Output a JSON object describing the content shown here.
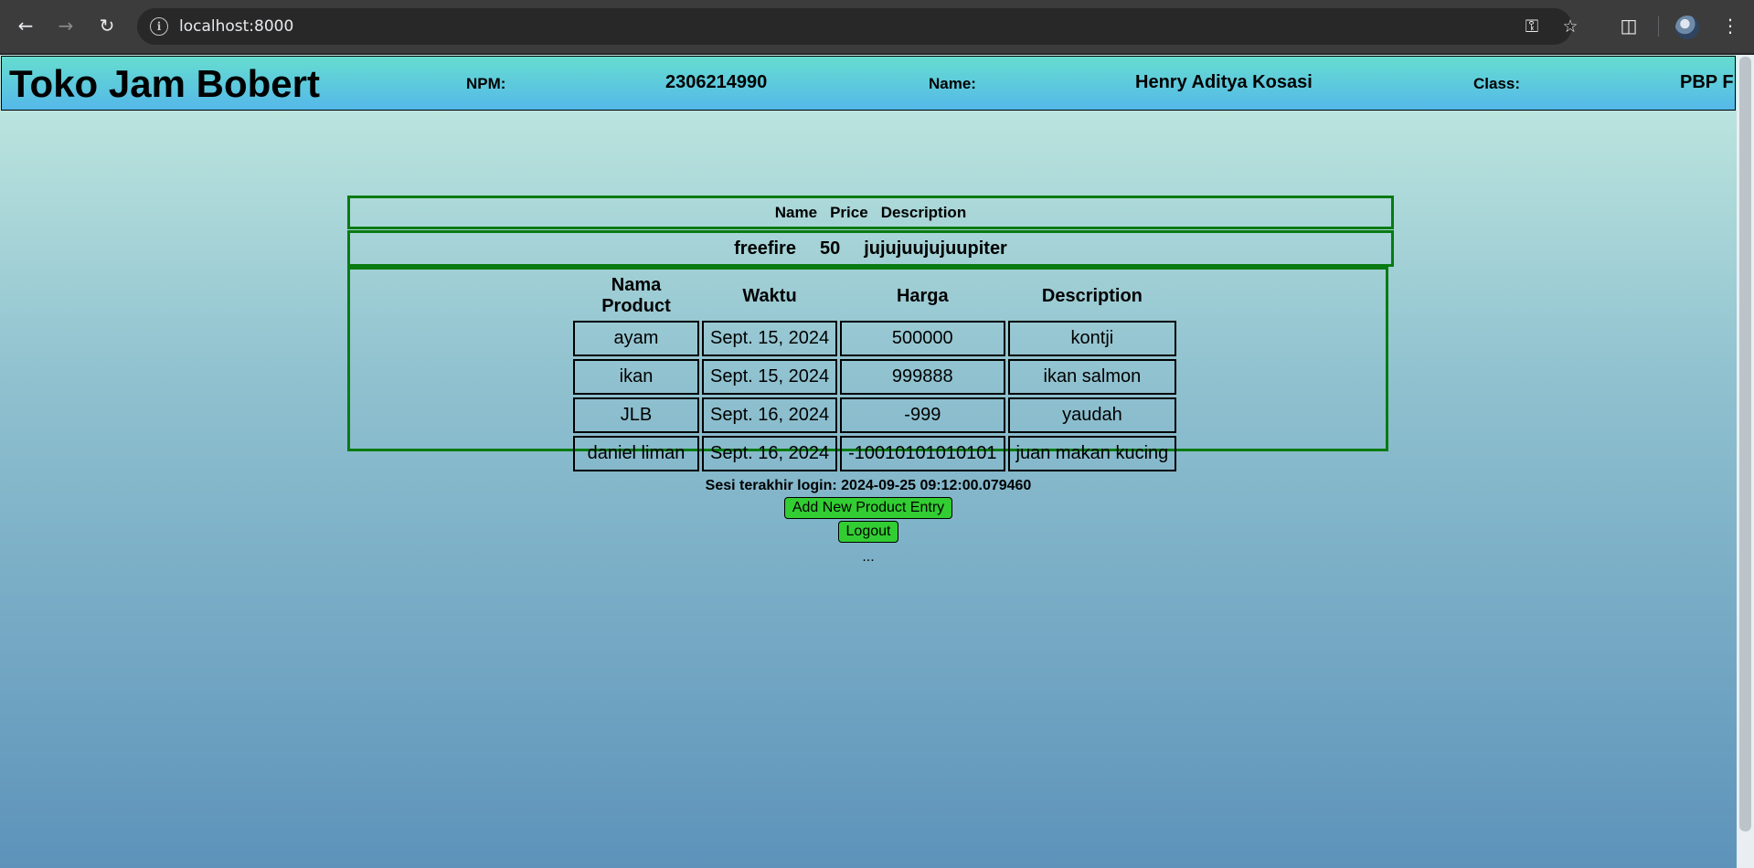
{
  "browser": {
    "url": "localhost:8000",
    "back_icon": "back-arrow-icon",
    "forward_icon": "forward-arrow-icon",
    "reload_icon": "reload-icon"
  },
  "header": {
    "title": "Toko Jam Bobert",
    "npm_label": "NPM:",
    "npm_value": "2306214990",
    "name_label": "Name:",
    "name_value": "Henry Aditya Kosasi",
    "class_label": "Class:",
    "class_value": "PBP F"
  },
  "product_header": {
    "labels": [
      "Name",
      "Price",
      "Description"
    ],
    "values": [
      "freefire",
      "50",
      "jujujuujujuupiter"
    ]
  },
  "table": {
    "columns": [
      "Nama Product",
      "Waktu",
      "Harga",
      "Description"
    ],
    "rows": [
      [
        "ayam",
        "Sept. 15, 2024",
        "500000",
        "kontji"
      ],
      [
        "ikan",
        "Sept. 15, 2024",
        "999888",
        "ikan salmon"
      ],
      [
        "JLB",
        "Sept. 16, 2024",
        "-999",
        "yaudah"
      ],
      [
        "daniel liman",
        "Sept. 16, 2024",
        "-10010101010101",
        "juan makan kucing"
      ]
    ]
  },
  "last_login": "Sesi terakhir login: 2024-09-25 09:12:00.079460",
  "buttons": {
    "add_product": "Add New Product Entry",
    "logout": "Logout"
  },
  "footer_ellipsis": "...",
  "colors": {
    "border_green": "#0a7a12",
    "button_green": "#32cd32"
  }
}
